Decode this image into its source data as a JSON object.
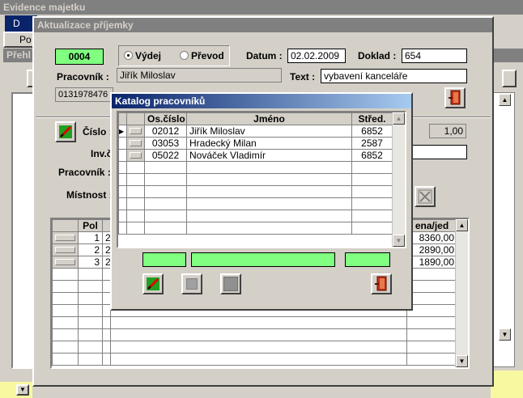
{
  "main_window": {
    "title": "Evidence majetku",
    "tab_1": "D",
    "tab_2": "Po",
    "tab_3": "Přehl"
  },
  "receipt_dialog": {
    "title": "Aktualizace příjemky",
    "number": "0004",
    "radio_vydej": "Výdej",
    "radio_prevod": "Převod",
    "datum_label": "Datum :",
    "datum_value": "02.02.2009",
    "doklad_label": "Doklad :",
    "doklad_value": "654",
    "pracovnik_label": "Pracovník :",
    "pracovnik_value": "Jiřík Miloslav",
    "text_label": "Text :",
    "text_value": "vybavení kanceláře",
    "code_value": "0131978476",
    "cislo_label": "Číslo :",
    "inv_label": "Inv.č",
    "pracovnik2_label": "Pracovník :",
    "mistnost_label": "Místnost :",
    "quantity_value": "1,00"
  },
  "items_table": {
    "headers": [
      "Pol",
      "",
      "ena/jed"
    ],
    "rows": [
      {
        "pol": "1",
        "code": "2",
        "price": "8360,00"
      },
      {
        "pol": "2",
        "code": "2",
        "price": "2890,00"
      },
      {
        "pol": "3",
        "code": "2",
        "price": "1890,00"
      }
    ]
  },
  "catalog_dialog": {
    "title": "Katalog pracovníků",
    "headers": [
      "Os.číslo",
      "Jméno",
      "Střed."
    ],
    "rows": [
      {
        "os": "02012",
        "name": "Jiřík Miloslav",
        "stred": "6852"
      },
      {
        "os": "03053",
        "name": "Hradecký Milan",
        "stred": "2587"
      },
      {
        "os": "05022",
        "name": "Nováček Vladimír",
        "stred": "6852"
      }
    ]
  },
  "colors": {
    "accent_green": "#80ff80",
    "title_active_start": "#0a246a",
    "title_active_end": "#a6caf0",
    "exit_red": "#c03018"
  }
}
